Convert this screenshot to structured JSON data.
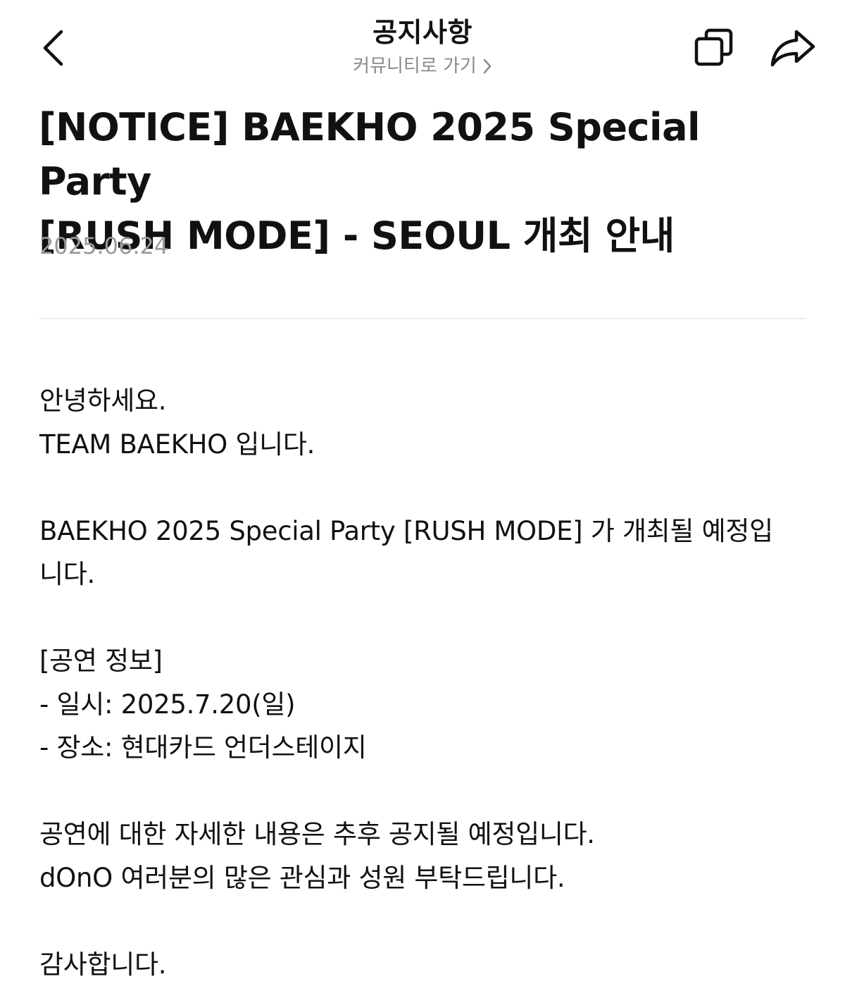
{
  "header": {
    "title": "공지사항",
    "community_link": "커뮤니티로 가기",
    "icons": {
      "back": "chevron-left-icon",
      "community_arrow": "chevron-right-icon",
      "copy": "copy-icon",
      "share": "share-icon"
    }
  },
  "article": {
    "title_line1": "[NOTICE] BAEKHO 2025 Special Party",
    "title_line2": "[RUSH MODE] - SEOUL 개최 안내",
    "date": "2025.06.24",
    "body": {
      "greeting": "안녕하세요.",
      "team": "TEAM BAEKHO 입니다.",
      "announce_line1": "BAEKHO 2025 Special Party [RUSH MODE] 가 개최될 예정입",
      "announce_line2": "니다.",
      "info_header": "[공연 정보]",
      "info_date": "- 일시: 2025.7.20(일)",
      "info_place": "- 장소: 현대카드 언더스테이지",
      "detail_notice": "공연에 대한 자세한 내용은 추후 공지될 예정입니다.",
      "request": "dOnO 여러분의 많은 관심과 성원 부탁드립니다.",
      "thanks": "감사합니다."
    }
  },
  "colors": {
    "text": "#111111",
    "muted": "#8a8a8a",
    "date": "#9a9a9a",
    "divider": "#efefef",
    "background": "#ffffff"
  }
}
